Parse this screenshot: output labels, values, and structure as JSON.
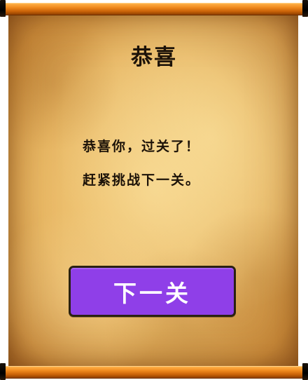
{
  "dialog": {
    "title": "恭喜",
    "message_line_1": "恭喜你，过关了！",
    "message_line_2": "赶紧挑战下一关。",
    "next_button_label": "下一关"
  },
  "colors": {
    "button_fill": "#8f3fe8",
    "button_border": "#2a2112",
    "text": "#1c1208",
    "rod": "#f08a1e"
  }
}
